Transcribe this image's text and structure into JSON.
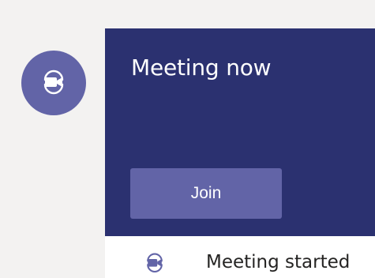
{
  "meeting": {
    "title": "Meeting now",
    "join_label": "Join",
    "status_text": "Meeting started"
  },
  "icons": {
    "avatar_icon": "video-camera-icon",
    "status_icon": "video-camera-icon"
  },
  "colors": {
    "brand": "#6264a7",
    "header_bg": "#2b3170",
    "page_bg": "#f3f2f1",
    "card_bg": "#ffffff",
    "text": "#252423"
  }
}
